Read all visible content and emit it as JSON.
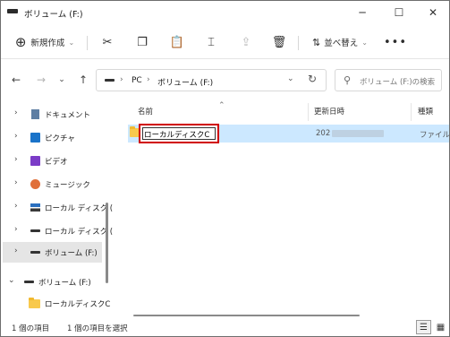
{
  "window": {
    "title": "ボリューム (F:)",
    "minimize_glyph": "─",
    "maximize_glyph": "☐",
    "close_glyph": "✕"
  },
  "toolbar": {
    "new_label": "新規作成",
    "sort_label": "並べ替え",
    "icons": [
      "cut-icon",
      "copy-icon",
      "paste-icon",
      "rename-icon",
      "share-icon",
      "delete-icon"
    ]
  },
  "address": {
    "segments": [
      "PC",
      "ボリューム (F:)"
    ],
    "search_placeholder": "ボリューム (F:)の検索"
  },
  "nav": {
    "items": [
      {
        "label": "ドキュメント",
        "icon": "documents-icon"
      },
      {
        "label": "ピクチャ",
        "icon": "pictures-icon"
      },
      {
        "label": "ビデオ",
        "icon": "videos-icon"
      },
      {
        "label": "ミュージック",
        "icon": "music-icon"
      },
      {
        "label": "ローカル ディスク (",
        "icon": "local-disk-icon"
      },
      {
        "label": "ローカル ディスク (",
        "icon": "drive-icon"
      },
      {
        "label": "ボリューム (F:)",
        "icon": "drive-icon"
      },
      {
        "label": "ボリューム (F:)",
        "icon": "drive-icon"
      },
      {
        "label": "ローカルディスクC",
        "icon": "folder-icon"
      }
    ]
  },
  "columns": {
    "name": "名前",
    "modified": "更新日時",
    "type": "種類"
  },
  "files": [
    {
      "name": "ローカルディスクC",
      "modified": "202",
      "type": "ファイル フ"
    }
  ],
  "status": {
    "count": "1 個の項目",
    "selected": "1 個の項目を選択"
  },
  "colors": {
    "selection": "#cce8ff",
    "rename_highlight": "#d00000",
    "folder": "#f8c94c"
  }
}
